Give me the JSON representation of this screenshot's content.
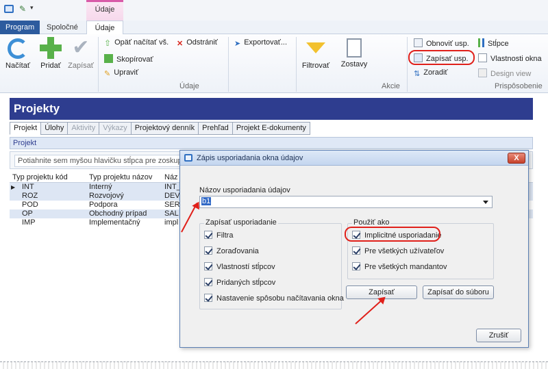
{
  "qat": {
    "context_tab": "Údaje"
  },
  "tabs": {
    "program": "Program",
    "spolocne": "Spoločné",
    "udaje": "Údaje"
  },
  "ribbon": {
    "nacitat": "Načítať",
    "pridat": "Pridať",
    "zapisat": "Zapísať",
    "opat_nacitat": "Opäť načítať vš.",
    "odstranit": "Odstrániť",
    "skopirovat": "Skopírovať",
    "upravit": "Upraviť",
    "exportovat": "Exportovať...",
    "filtrovat": "Filtrovať",
    "zostavy": "Zostavy",
    "obnovit_usp": "Obnoviť usp.",
    "zapisat_usp": "Zapísať usp.",
    "zoradit": "Zoradiť",
    "stlpce": "Stĺpce",
    "vlastnosti_okna": "Vlastnosti okna",
    "design_view": "Design view",
    "group_udaje": "Údaje",
    "group_akcie": "Akcie",
    "group_prisposobenie": "Prispôsobenie"
  },
  "projekty": {
    "title": "Projekty"
  },
  "inner_tabs": [
    "Projekt",
    "Úlohy",
    "Aktivity",
    "Výkazy",
    "Projektový denník",
    "Prehľad",
    "Projekt E-dokumenty"
  ],
  "projekt_bar": "Projekt",
  "grouping_text": "Potiahnite sem myšou hlavičku stĺpca pre zoskup",
  "grid": {
    "headers": [
      "Typ projektu kód",
      "Typ projektu názov",
      "Náz"
    ],
    "rows": [
      [
        "INT",
        "Interný",
        "INT_"
      ],
      [
        "ROZ",
        "Rozvojový",
        "DEV_"
      ],
      [
        "POD",
        "Podpora",
        "SER"
      ],
      [
        "OP",
        "Obchodný prípad",
        "SAL"
      ],
      [
        "IMP",
        "Implementačný",
        "impl"
      ]
    ]
  },
  "dialog": {
    "title": "Zápis usporiadania okna údajov",
    "close": "X",
    "name_label": "Názov usporiadania údajov",
    "name_value": "b1",
    "group_write": "Zapísať usporiadanie",
    "write_items": [
      "Filtra",
      "Zoraďovania",
      "Vlastností stĺpcov",
      "Pridaných stĺpcov",
      "Nastavenie spôsobu načítavania okna"
    ],
    "group_use": "Použiť ako",
    "use_items": [
      "Implicitné usporiadanie",
      "Pre všetkých užívateľov",
      "Pre všetkých mandantov"
    ],
    "btn_write": "Zapísať",
    "btn_write_file": "Zapísať do súboru",
    "btn_cancel": "Zrušiť"
  }
}
